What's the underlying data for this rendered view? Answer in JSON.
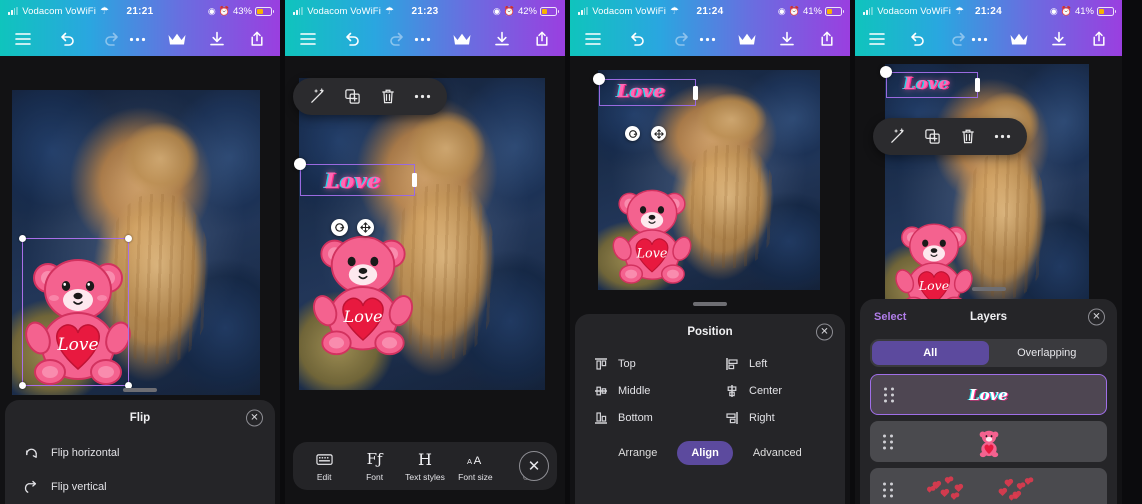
{
  "panels": [
    {
      "id": "panel-flip",
      "status": {
        "carrier": "Vodacom VoWiFi",
        "time": "21:21",
        "battery": "43%"
      },
      "toolbar": {
        "menu": "menu-icon",
        "undo": "undo-icon",
        "redo": "redo-icon",
        "more": "more-icon",
        "crown": "crown-icon",
        "download": "download-icon",
        "share": "share-icon"
      },
      "sheet": {
        "title": "Flip",
        "close": "✕",
        "items": [
          {
            "label": "Flip horizontal",
            "icon": "flip-horizontal-icon"
          },
          {
            "label": "Flip vertical",
            "icon": "flip-vertical-icon"
          }
        ]
      }
    },
    {
      "id": "panel-text-toolbar",
      "status": {
        "carrier": "Vodacom VoWiFi",
        "time": "21:23",
        "battery": "42%"
      },
      "context_toolbar": [
        "magic-wand-icon",
        "duplicate-icon",
        "trash-icon",
        "more-icon"
      ],
      "sticker_text": "Love",
      "text_toolbar": {
        "items": [
          {
            "label": "Edit",
            "glyph": "⌨",
            "icon": "edit-icon"
          },
          {
            "label": "Font",
            "glyph": "Fƒ",
            "icon": "font-icon"
          },
          {
            "label": "Text styles",
            "glyph": "H",
            "icon": "text-styles-icon"
          },
          {
            "label": "Font size",
            "glyph": "ᴀA",
            "icon": "font-size-icon"
          },
          {
            "label": "C",
            "glyph": "◉",
            "icon": "color-icon"
          }
        ],
        "close": "✕"
      }
    },
    {
      "id": "panel-position",
      "status": {
        "carrier": "Vodacom VoWiFi",
        "time": "21:24",
        "battery": "41%"
      },
      "sticker_text": "Love",
      "sheet": {
        "title": "Position",
        "close": "✕",
        "align_options": [
          {
            "label": "Top",
            "icon": "align-top-icon"
          },
          {
            "label": "Left",
            "icon": "align-left-icon"
          },
          {
            "label": "Middle",
            "icon": "align-middle-icon"
          },
          {
            "label": "Center",
            "icon": "align-center-icon"
          },
          {
            "label": "Bottom",
            "icon": "align-bottom-icon"
          },
          {
            "label": "Right",
            "icon": "align-right-icon"
          }
        ],
        "tabs": [
          {
            "label": "Arrange",
            "active": false
          },
          {
            "label": "Align",
            "active": true
          },
          {
            "label": "Advanced",
            "active": false
          }
        ]
      }
    },
    {
      "id": "panel-layers",
      "status": {
        "carrier": "Vodacom VoWiFi",
        "time": "21:24",
        "battery": "41%"
      },
      "context_toolbar": [
        "magic-wand-icon",
        "duplicate-icon",
        "trash-icon",
        "more-icon"
      ],
      "sticker_text": "Love",
      "sheet": {
        "left_link": "Select",
        "title": "Layers",
        "close": "✕",
        "segments": [
          {
            "label": "All",
            "active": true
          },
          {
            "label": "Overlapping",
            "active": false
          }
        ],
        "rows": [
          {
            "type": "text",
            "label": "Love",
            "selected": true
          },
          {
            "type": "teddy",
            "label": "",
            "selected": false
          },
          {
            "type": "hearts",
            "label": "",
            "selected": false
          }
        ]
      }
    }
  ],
  "colors": {
    "accent_purple": "#5c4a9e",
    "link_purple": "#b07de8",
    "selection": "#9a6ae0",
    "sticker_pink": "#ff69b4",
    "battery": "#f5b400"
  }
}
